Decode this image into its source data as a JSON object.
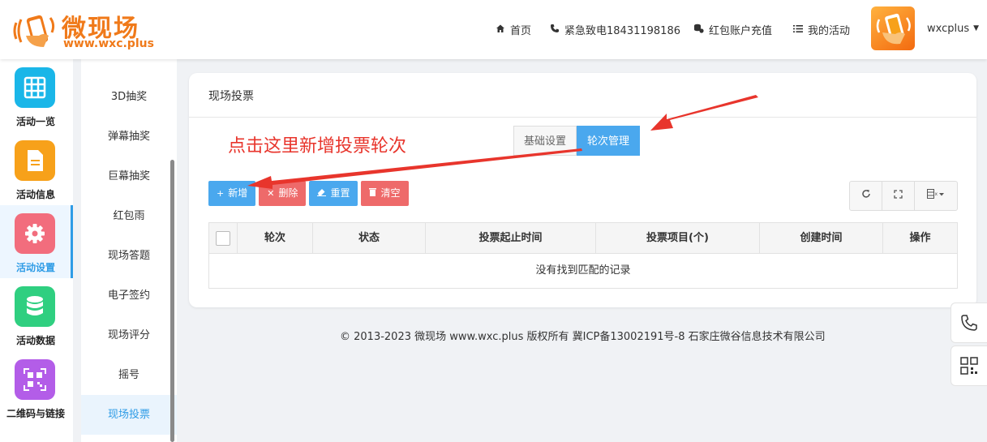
{
  "header": {
    "brand": "微现场",
    "domain": "www.wxc.plus",
    "nav": [
      {
        "label": "首页",
        "icon": "home-icon"
      },
      {
        "label": "紧急致电18431198186",
        "icon": "phone-icon"
      },
      {
        "label": "红包账户充值",
        "icon": "coins-icon"
      },
      {
        "label": "我的活动",
        "icon": "list-icon"
      }
    ],
    "username": "wxcplus"
  },
  "rail": [
    {
      "label": "活动一览",
      "icon": "grid-icon",
      "color": "#1ab6e8"
    },
    {
      "label": "活动信息",
      "icon": "document-icon",
      "color": "#f7a11a"
    },
    {
      "label": "活动设置",
      "icon": "gear-icon",
      "color": "#f26d7d"
    },
    {
      "label": "活动数据",
      "icon": "database-icon",
      "color": "#2fcf80"
    },
    {
      "label": "二维码与链接",
      "icon": "qrcode-icon",
      "color": "#b35de8"
    }
  ],
  "submenu": [
    "3D抽奖",
    "弹幕抽奖",
    "巨幕抽奖",
    "红包雨",
    "现场答题",
    "电子签约",
    "现场评分",
    "摇号",
    "现场投票"
  ],
  "panel": {
    "title": "现场投票",
    "annotation": "点击这里新增投票轮次",
    "tabs": [
      "基础设置",
      "轮次管理"
    ],
    "toolbar": {
      "add": "新增",
      "delete": "删除",
      "reset": "重置",
      "clear": "清空"
    },
    "table": {
      "columns": [
        "轮次",
        "状态",
        "投票起止时间",
        "投票项目(个)",
        "创建时间",
        "操作"
      ],
      "empty": "没有找到匹配的记录"
    }
  },
  "footer": "© 2013-2023 微现场 www.wxc.plus 版权所有 冀ICP备13002191号-8 石家庄微谷信息技术有限公司",
  "colors": {
    "accent": "#4aa8ee",
    "danger": "#ee6a6a",
    "annotation": "#e8352c",
    "brand": "#f07a1a"
  }
}
